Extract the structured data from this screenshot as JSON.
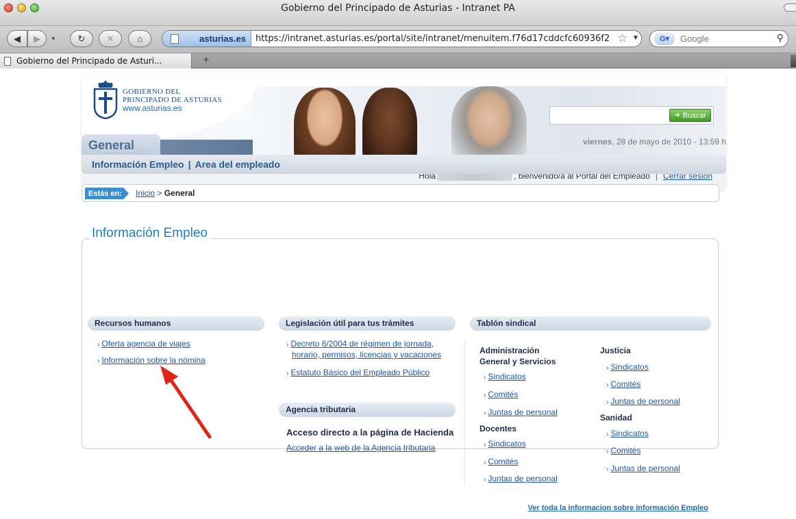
{
  "window": {
    "title": "Gobierno del Principado de Asturias - Intranet PA"
  },
  "toolbar": {
    "site_identity": "asturias.es",
    "url": "https://intranet.asturias.es/portal/site/intranet/menuitem.f76d17cddcfc60936f2",
    "search_engine_placeholder": "Google"
  },
  "tabs": [
    {
      "label": "Gobierno del Principado de Asturi..."
    }
  ],
  "header": {
    "brand_line1": "GOBIERNO DEL",
    "brand_line2": "PRINCIPADO DE ASTURIAS",
    "brand_web": "www.asturias.es",
    "search_button": "Buscar",
    "greeting_prefix": "Hola",
    "greeting_suffix": ", bienvenido/a al Portal del Empleado",
    "logout": "Cerrar sesión"
  },
  "section": {
    "tab": "General",
    "date_day": "viernes",
    "date_rest": ", 28 de mayo de 2010 - 13:59 h",
    "subnav": [
      "Información Empleo",
      "Area del empleado"
    ]
  },
  "breadcrumb": {
    "label": "Estás en:",
    "home": "Inicio",
    "separator": ">",
    "current": "General"
  },
  "info": {
    "title": "Información Empleo",
    "rrhh": {
      "heading": "Recursos humanos",
      "links": [
        "Oferta agencia de viajes",
        "Información sobre la nómina"
      ]
    },
    "legislacion": {
      "heading": "Legislación útil para tus trámites",
      "link1_line1": "Decreto 6/2004 de régimen de jornada,",
      "link1_line2": "horario, permisos, licencias y vacaciones",
      "link2": "Estatuto Básico del Empleado Público"
    },
    "agencia": {
      "heading": "Agencia tributaria",
      "subheading": "Acceso directo a la página de Hacienda",
      "link": "Acceder a la web de la Agencia tributaria"
    },
    "tablon": {
      "heading": "Tablón sindical",
      "admin_line1": "Administración",
      "admin_line2": "General y Servicios",
      "justicia": "Justicia",
      "docentes": "Docentes",
      "sanidad": "Sanidad",
      "sindicatos": "Sindicatos",
      "comites": "Comités",
      "juntas": "Juntas de personal"
    },
    "footer_link": "Ver toda la informacion sobre Información Empleo"
  },
  "colors": {
    "link": "#1d56a8",
    "title_blue": "#1f7fc0",
    "annotation_arrow": "#e02418"
  }
}
